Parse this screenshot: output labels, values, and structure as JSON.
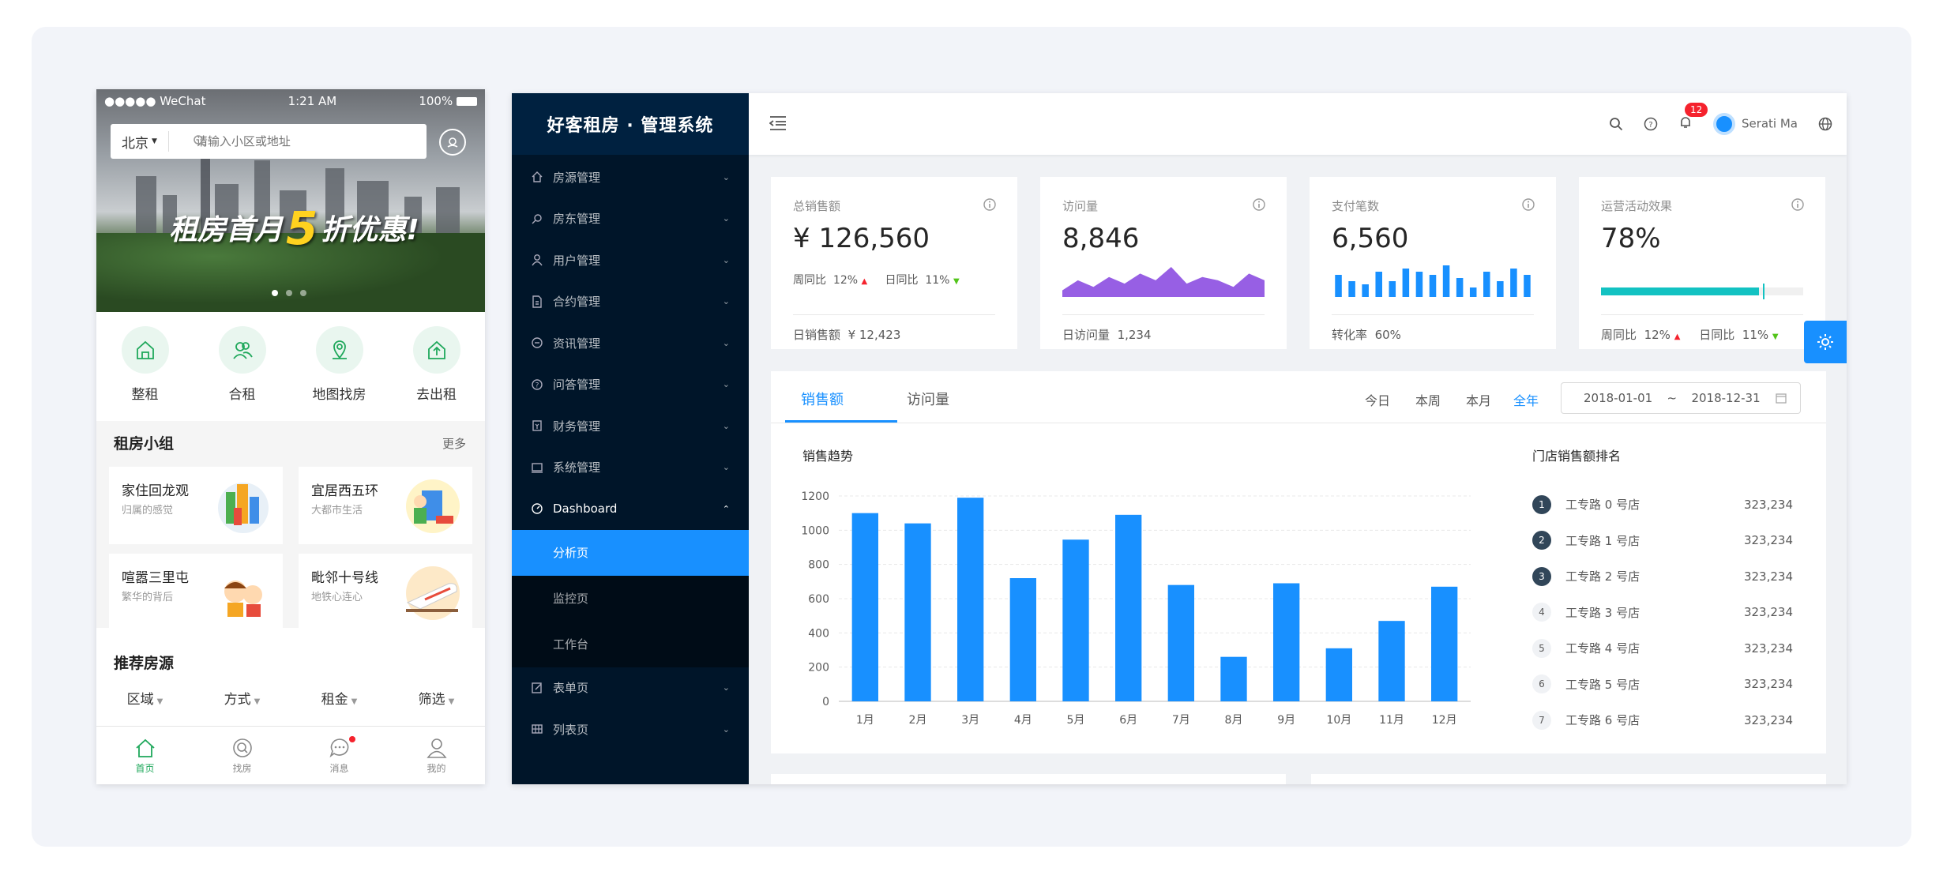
{
  "phone": {
    "status": {
      "carrier": "●●●●● WeChat",
      "time": "1:21 AM",
      "battery": "100%"
    },
    "search": {
      "city": "北京",
      "placeholder": "请输入小区或地址"
    },
    "banner": {
      "text_a": "租房首月",
      "text_b": "5",
      "text_c": "折优惠!"
    },
    "quick": [
      {
        "label": "整租",
        "icon": "house-icon"
      },
      {
        "label": "合租",
        "icon": "people-icon"
      },
      {
        "label": "地图找房",
        "icon": "map-pin-icon"
      },
      {
        "label": "去出租",
        "icon": "rent-out-icon"
      }
    ],
    "group": {
      "title": "租房小组",
      "more": "更多",
      "items": [
        {
          "title": "家住回龙观",
          "sub": "归属的感觉"
        },
        {
          "title": "宜居西五环",
          "sub": "大都市生活"
        },
        {
          "title": "喧嚣三里屯",
          "sub": "繁华的背后"
        },
        {
          "title": "毗邻十号线",
          "sub": "地铁心连心"
        }
      ]
    },
    "recommend": {
      "title": "推荐房源",
      "filters": [
        "区域",
        "方式",
        "租金",
        "筛选"
      ]
    },
    "tabbar": [
      {
        "label": "首页"
      },
      {
        "label": "找房"
      },
      {
        "label": "消息"
      },
      {
        "label": "我的"
      }
    ]
  },
  "admin": {
    "title": "好客租房 · 管理系统",
    "menu": [
      {
        "label": "房源管理",
        "icon": "home-icon"
      },
      {
        "label": "房东管理",
        "icon": "search-user-icon"
      },
      {
        "label": "用户管理",
        "icon": "user-icon"
      },
      {
        "label": "合约管理",
        "icon": "file-icon"
      },
      {
        "label": "资讯管理",
        "icon": "message-icon"
      },
      {
        "label": "问答管理",
        "icon": "question-icon"
      },
      {
        "label": "财务管理",
        "icon": "finance-icon"
      },
      {
        "label": "系统管理",
        "icon": "laptop-icon"
      },
      {
        "label": "Dashboard",
        "icon": "dashboard-icon"
      }
    ],
    "submenu": [
      "分析页",
      "监控页",
      "工作台"
    ],
    "menu_after": [
      {
        "label": "表单页",
        "icon": "form-icon"
      },
      {
        "label": "列表页",
        "icon": "table-icon"
      }
    ],
    "header": {
      "notifications": "12",
      "user": "Serati Ma"
    },
    "cards": [
      {
        "title": "总销售额",
        "value": "¥ 126,560",
        "week_label": "周同比",
        "week_val": "12%",
        "day_label": "日同比",
        "day_val": "11%",
        "foot_label": "日销售额",
        "foot_val": "¥ 12,423"
      },
      {
        "title": "访问量",
        "value": "8,846",
        "foot_label": "日访问量",
        "foot_val": "1,234"
      },
      {
        "title": "支付笔数",
        "value": "6,560",
        "foot_label": "转化率",
        "foot_val": "60%"
      },
      {
        "title": "运营活动效果",
        "value": "78%",
        "week_label": "周同比",
        "week_val": "12%",
        "day_label": "日同比",
        "day_val": "11%"
      }
    ],
    "progress": 0.78,
    "tabs": [
      "销售额",
      "访问量"
    ],
    "ranges": [
      "今日",
      "本周",
      "本月",
      "全年"
    ],
    "date_start": "2018-01-01",
    "date_sep": "~",
    "date_end": "2018-12-31",
    "chart_title": "销售趋势",
    "rank_title": "门店销售额排名",
    "rank": [
      {
        "no": "1",
        "name": "工专路 0 号店",
        "value": "323,234"
      },
      {
        "no": "2",
        "name": "工专路 1 号店",
        "value": "323,234"
      },
      {
        "no": "3",
        "name": "工专路 2 号店",
        "value": "323,234"
      },
      {
        "no": "4",
        "name": "工专路 3 号店",
        "value": "323,234"
      },
      {
        "no": "5",
        "name": "工专路 4 号店",
        "value": "323,234"
      },
      {
        "no": "6",
        "name": "工专路 5 号店",
        "value": "323,234"
      },
      {
        "no": "7",
        "name": "工专路 6 号店",
        "value": "323,234"
      }
    ],
    "colors": {
      "primary": "#1890ff",
      "sider": "#001529",
      "visit_area": "#975fe4",
      "progress": "#13c2c2"
    }
  },
  "chart_data": {
    "type": "bar",
    "title": "销售趋势",
    "categories": [
      "1月",
      "2月",
      "3月",
      "4月",
      "5月",
      "6月",
      "7月",
      "8月",
      "9月",
      "10月",
      "11月",
      "12月"
    ],
    "values": [
      1100,
      1040,
      1190,
      720,
      945,
      1090,
      680,
      260,
      690,
      310,
      470,
      670
    ],
    "ylim": [
      0,
      1200
    ],
    "yticks": [
      0,
      200,
      400,
      600,
      800,
      1000,
      1200
    ],
    "grid": true
  },
  "mini_charts": {
    "visits_area": [
      2,
      5,
      3,
      6,
      4,
      7,
      5,
      9,
      4,
      6,
      5,
      3,
      7,
      5
    ],
    "payments_bar": [
      7,
      5,
      4,
      8,
      5,
      9,
      8,
      7,
      10,
      6,
      3,
      8,
      5,
      9,
      7
    ]
  }
}
